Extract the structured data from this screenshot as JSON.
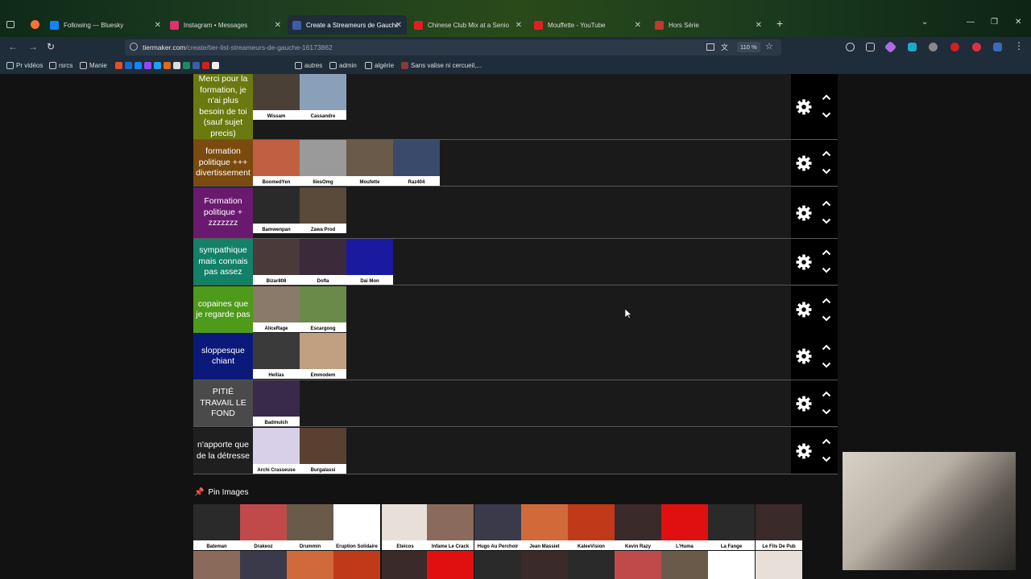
{
  "browser": {
    "tabs": [
      {
        "label": "Following — Bluesky",
        "color": "#1185fe",
        "active": false
      },
      {
        "label": "Instagram • Messages",
        "color": "#e1306c",
        "active": false
      },
      {
        "label": "Create a Streameurs de Gauche",
        "color": "#3a5ea8",
        "active": true
      },
      {
        "label": "Chinese Club Mix at a Senio",
        "color": "#e02020",
        "active": false
      },
      {
        "label": "Mouffette - YouTube",
        "color": "#e02020",
        "active": false
      },
      {
        "label": "Hors Série",
        "color": "#c0392b",
        "active": false
      }
    ],
    "url_host": "tiermaker.com",
    "url_path": "/create/tier-list-streameurs-de-gauche-16173862",
    "zoom": "110 %",
    "bookmarks": [
      "Pr vidéos",
      "rsrcs",
      "Manie",
      "autres",
      "admin",
      "algérie",
      "Sans valise ni cercueil,..."
    ]
  },
  "tiers": [
    {
      "label": "Merci pour la formation, je n'ai plus besoin de toi (sauf sujet precis)",
      "color": "#6b7a0e",
      "items": [
        "Wissam",
        "Cassandre"
      ]
    },
    {
      "label": "formation politique +++ divertissement",
      "color": "#7a4a0e",
      "items": [
        "BoomedYen",
        "IliesOmg",
        "Moufette",
        "Raz404"
      ]
    },
    {
      "label": "Formation politique + zzzzzzz",
      "color": "#6a1a6e",
      "items": [
        "Bamwenpan",
        "Zawa Prod"
      ]
    },
    {
      "label": "sympathique mais connais pas assez",
      "color": "#138068",
      "items": [
        "Bizar808",
        "Dofla",
        "Dai Mon"
      ]
    },
    {
      "label": "copaines que je regarde pas",
      "color": "#4e9a1a",
      "items": [
        "AliceRage",
        "Escargoog"
      ]
    },
    {
      "label": "sloppesque chiant",
      "color": "#0b1a7a",
      "items": [
        "Hellias",
        "Emmodem"
      ]
    },
    {
      "label": "PITIÉ TRAVAIL LE FOND",
      "color": "#4a4a4a",
      "items": [
        "Badmulch"
      ]
    },
    {
      "label": "n'apporte que de la détresse",
      "color": "#1f1f1f",
      "items": [
        "Archi Crasseuse",
        "Burgalassi"
      ]
    }
  ],
  "pin_images_label": "Pin Images",
  "pool": [
    "Bateman",
    "Drakeoz",
    "Drummin",
    "Eruption Solidaire",
    "Eteicos",
    "Infame Le Crack",
    "Hugo Au Perchoir",
    "Jean Massiet",
    "KaleeVision",
    "Kevin Razy",
    "L'Huma",
    "La Fange",
    "Le Fils De Pub"
  ]
}
